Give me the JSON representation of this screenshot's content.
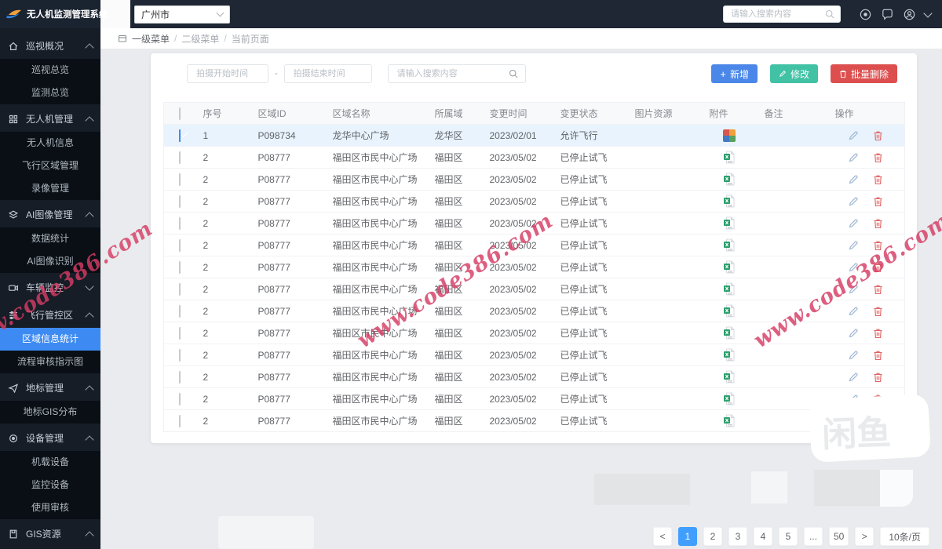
{
  "app": {
    "title": "无人机监测管理系统"
  },
  "topbar": {
    "city": "广州市",
    "search_placeholder": "请输入搜索内容",
    "icons": [
      "target-icon",
      "message-icon",
      "user-avatar-icon",
      "chevron-down-icon"
    ]
  },
  "breadcrumb": {
    "items": [
      "一级菜单",
      "二级菜单",
      "当前页面"
    ]
  },
  "sidebar": {
    "groups": [
      {
        "label": "巡视概况",
        "icon": "home",
        "expanded": true,
        "children": [
          "巡视总览",
          "监测总览"
        ]
      },
      {
        "label": "无人机管理",
        "icon": "grid",
        "expanded": true,
        "children": [
          "无人机信息",
          "飞行区域管理",
          "录像管理"
        ]
      },
      {
        "label": "AI图像管理",
        "icon": "layers",
        "expanded": true,
        "children": [
          "数据统计",
          "AI图像识别"
        ]
      },
      {
        "label": "车辆监控",
        "icon": "camera",
        "expanded": false,
        "children": []
      },
      {
        "label": "飞行管控区",
        "icon": "sliders",
        "expanded": true,
        "children": [
          "区域信息统计",
          "流程审核指示图"
        ],
        "active_child": "区域信息统计"
      },
      {
        "label": "地标管理",
        "icon": "send",
        "expanded": true,
        "children": [
          "地标GIS分布"
        ]
      },
      {
        "label": "设备管理",
        "icon": "gear",
        "expanded": true,
        "children": [
          "机载设备",
          "监控设备",
          "使用审核"
        ]
      },
      {
        "label": "GIS资源",
        "icon": "doc",
        "expanded": true,
        "children": []
      }
    ]
  },
  "filters": {
    "start_placeholder": "拍摄开始时间",
    "separator": "-",
    "end_placeholder": "拍摄结束时间",
    "search_placeholder": "请输入搜索内容",
    "buttons": {
      "add": "新增",
      "edit": "修改",
      "batch_delete": "批量删除"
    }
  },
  "table": {
    "columns": [
      "序号",
      "区域ID",
      "区域名称",
      "所属域",
      "变更时间",
      "变更状态",
      "图片资源",
      "附件",
      "备注",
      "操作"
    ],
    "rows": [
      {
        "checked": true,
        "seq": "1",
        "area_id": "P098734",
        "area_name": "龙华中心广场",
        "district": "龙华区",
        "change_time": "2023/02/01",
        "status": "允许飞行",
        "attachment": "image",
        "remark": ""
      },
      {
        "checked": false,
        "seq": "2",
        "area_id": "P08777",
        "area_name": "福田区市民中心广场",
        "district": "福田区",
        "change_time": "2023/05/02",
        "status": "已停止试飞",
        "attachment": "excel",
        "remark": ""
      },
      {
        "checked": false,
        "seq": "2",
        "area_id": "P08777",
        "area_name": "福田区市民中心广场",
        "district": "福田区",
        "change_time": "2023/05/02",
        "status": "已停止试飞",
        "attachment": "excel",
        "remark": ""
      },
      {
        "checked": false,
        "seq": "2",
        "area_id": "P08777",
        "area_name": "福田区市民中心广场",
        "district": "福田区",
        "change_time": "2023/05/02",
        "status": "已停止试飞",
        "attachment": "excel",
        "remark": ""
      },
      {
        "checked": false,
        "seq": "2",
        "area_id": "P08777",
        "area_name": "福田区市民中心广场",
        "district": "福田区",
        "change_time": "2023/05/02",
        "status": "已停止试飞",
        "attachment": "excel",
        "remark": ""
      },
      {
        "checked": false,
        "seq": "2",
        "area_id": "P08777",
        "area_name": "福田区市民中心广场",
        "district": "福田区",
        "change_time": "2023/05/02",
        "status": "已停止试飞",
        "attachment": "excel",
        "remark": ""
      },
      {
        "checked": false,
        "seq": "2",
        "area_id": "P08777",
        "area_name": "福田区市民中心广场",
        "district": "福田区",
        "change_time": "2023/05/02",
        "status": "已停止试飞",
        "attachment": "excel",
        "remark": ""
      },
      {
        "checked": false,
        "seq": "2",
        "area_id": "P08777",
        "area_name": "福田区市民中心广场",
        "district": "福田区",
        "change_time": "2023/05/02",
        "status": "已停止试飞",
        "attachment": "excel",
        "remark": ""
      },
      {
        "checked": false,
        "seq": "2",
        "area_id": "P08777",
        "area_name": "福田区市民中心广场",
        "district": "福田区",
        "change_time": "2023/05/02",
        "status": "已停止试飞",
        "attachment": "excel",
        "remark": ""
      },
      {
        "checked": false,
        "seq": "2",
        "area_id": "P08777",
        "area_name": "福田区市民中心广场",
        "district": "福田区",
        "change_time": "2023/05/02",
        "status": "已停止试飞",
        "attachment": "excel",
        "remark": ""
      },
      {
        "checked": false,
        "seq": "2",
        "area_id": "P08777",
        "area_name": "福田区市民中心广场",
        "district": "福田区",
        "change_time": "2023/05/02",
        "status": "已停止试飞",
        "attachment": "excel",
        "remark": ""
      },
      {
        "checked": false,
        "seq": "2",
        "area_id": "P08777",
        "area_name": "福田区市民中心广场",
        "district": "福田区",
        "change_time": "2023/05/02",
        "status": "已停止试飞",
        "attachment": "excel",
        "remark": ""
      },
      {
        "checked": false,
        "seq": "2",
        "area_id": "P08777",
        "area_name": "福田区市民中心广场",
        "district": "福田区",
        "change_time": "2023/05/02",
        "status": "已停止试飞",
        "attachment": "excel",
        "remark": ""
      },
      {
        "checked": false,
        "seq": "2",
        "area_id": "P08777",
        "area_name": "福田区市民中心广场",
        "district": "福田区",
        "change_time": "2023/05/02",
        "status": "已停止试飞",
        "attachment": "excel",
        "remark": ""
      }
    ]
  },
  "pagination": {
    "prev": "<",
    "pages": [
      "1",
      "2",
      "3",
      "4",
      "5",
      "...",
      "50"
    ],
    "active": "1",
    "next": ">",
    "page_size": "10条/页"
  },
  "watermark": {
    "text": "www.code386.com",
    "color": "#d63c64"
  },
  "overlay": {
    "xianyu": "闲鱼"
  }
}
